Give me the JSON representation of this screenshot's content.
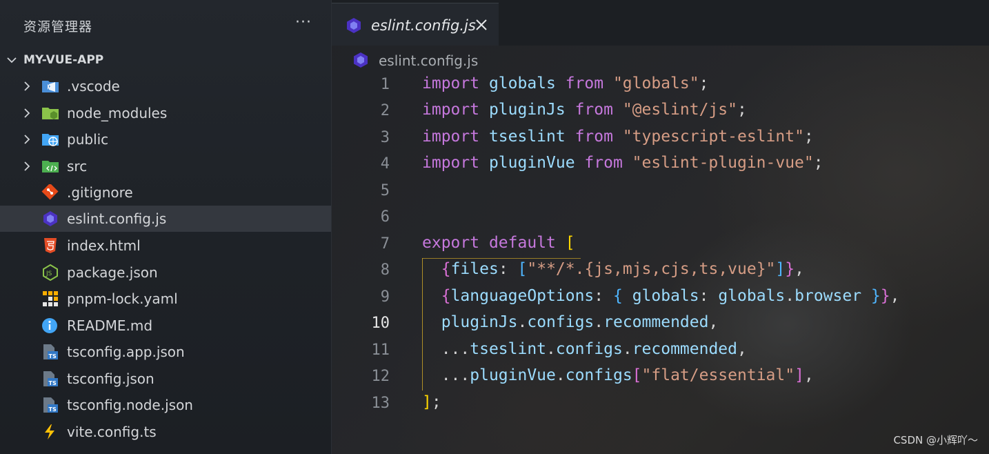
{
  "explorer": {
    "title": "资源管理器",
    "more_label": "···",
    "project": "MY-VUE-APP",
    "items": [
      {
        "label": ".vscode",
        "type": "folder",
        "icon": "vscode-folder-icon"
      },
      {
        "label": "node_modules",
        "type": "folder",
        "icon": "node-folder-icon"
      },
      {
        "label": "public",
        "type": "folder",
        "icon": "public-folder-icon"
      },
      {
        "label": "src",
        "type": "folder",
        "icon": "src-folder-icon"
      },
      {
        "label": ".gitignore",
        "type": "file",
        "icon": "git-icon"
      },
      {
        "label": "eslint.config.js",
        "type": "file",
        "icon": "eslint-icon",
        "active": true
      },
      {
        "label": "index.html",
        "type": "file",
        "icon": "html5-icon"
      },
      {
        "label": "package.json",
        "type": "file",
        "icon": "nodejs-icon"
      },
      {
        "label": "pnpm-lock.yaml",
        "type": "file",
        "icon": "pnpm-icon"
      },
      {
        "label": "README.md",
        "type": "file",
        "icon": "info-icon"
      },
      {
        "label": "tsconfig.app.json",
        "type": "file",
        "icon": "tsconfig-icon"
      },
      {
        "label": "tsconfig.json",
        "type": "file",
        "icon": "tsconfig-icon"
      },
      {
        "label": "tsconfig.node.json",
        "type": "file",
        "icon": "tsconfig-icon"
      },
      {
        "label": "vite.config.ts",
        "type": "file",
        "icon": "vite-icon"
      }
    ]
  },
  "editor": {
    "tab_label": "eslint.config.js",
    "breadcrumb": "eslint.config.js",
    "current_line": 10,
    "line_numbers": [
      "1",
      "2",
      "3",
      "4",
      "5",
      "6",
      "7",
      "8",
      "9",
      "10",
      "11",
      "12",
      "13"
    ]
  },
  "code": {
    "l1": {
      "t1": "import",
      "t2": " globals ",
      "t3": "from",
      "t4": " \"globals\"",
      "t5": ";"
    },
    "l2": {
      "t1": "import",
      "t2": " pluginJs ",
      "t3": "from",
      "t4": " \"@eslint/js\"",
      "t5": ";"
    },
    "l3": {
      "t1": "import",
      "t2": " tseslint ",
      "t3": "from",
      "t4": " \"typescript-eslint\"",
      "t5": ";"
    },
    "l4": {
      "t1": "import",
      "t2": " pluginVue ",
      "t3": "from",
      "t4": " \"eslint-plugin-vue\"",
      "t5": ";"
    },
    "l7": {
      "t1": "export",
      "t2": " ",
      "t3": "default",
      "t4": " ",
      "t5": "["
    },
    "l8": {
      "t0": "  ",
      "t1": "{",
      "t2": "files",
      "t3": ": ",
      "t4": "[",
      "t5": "\"**/*.{js,mjs,cjs,ts,vue}\"",
      "t6": "]",
      "t7": "}",
      "t8": ","
    },
    "l9": {
      "t0": "  ",
      "t1": "{",
      "t2": "languageOptions",
      "t3": ": ",
      "t4": "{",
      "t5": " globals",
      "t6": ": ",
      "t7": "globals",
      "t8": ".",
      "t9": "browser",
      "t10": " ",
      "t11": "}",
      "t12": "}",
      "t13": ","
    },
    "l10": {
      "t0": "  ",
      "t1": "pluginJs",
      "t2": ".",
      "t3": "configs",
      "t4": ".",
      "t5": "recommended",
      "t6": ","
    },
    "l11": {
      "t0": "  ",
      "t1": "...",
      "t2": "tseslint",
      "t3": ".",
      "t4": "configs",
      "t5": ".",
      "t6": "recommended",
      "t7": ","
    },
    "l12": {
      "t0": "  ",
      "t1": "...",
      "t2": "pluginVue",
      "t3": ".",
      "t4": "configs",
      "t5": "[",
      "t6": "\"flat/essential\"",
      "t7": "]",
      "t8": ","
    },
    "l13": {
      "t1": "]",
      "t2": ";"
    }
  },
  "watermark": "CSDN @小辉吖～"
}
